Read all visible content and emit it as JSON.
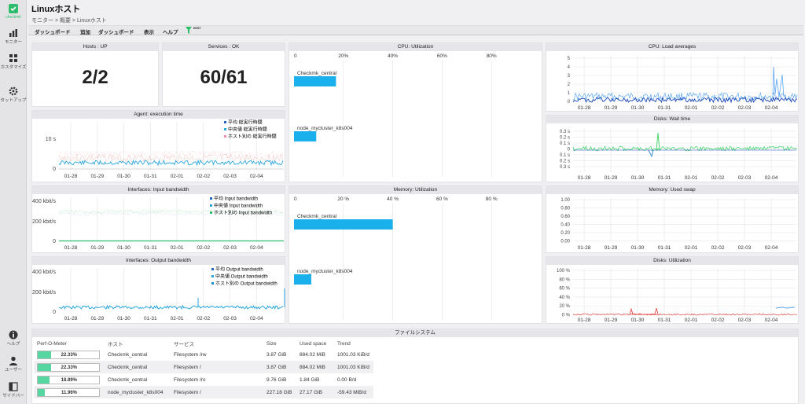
{
  "sidebar": {
    "logo": "checkmk",
    "items": [
      {
        "label": "モニター",
        "icon": "bar-chart-icon"
      },
      {
        "label": "カスタマイズ",
        "icon": "grid-icon"
      },
      {
        "label": "セットアップ",
        "icon": "gear-icon"
      }
    ],
    "bottom": [
      {
        "label": "ヘルプ",
        "icon": "info-icon"
      },
      {
        "label": "ユーザー",
        "icon": "user-icon"
      },
      {
        "label": "サイドバー",
        "icon": "sidebar-icon"
      }
    ]
  },
  "header": {
    "title": "Linuxホスト",
    "breadcrumb": "モニター > 概要 > Linuxホスト"
  },
  "menu": {
    "items": [
      "ダッシュボード",
      "追加",
      "ダッシュボード",
      "表示",
      "ヘルプ"
    ],
    "filter_badge": "HOST"
  },
  "dashlets": {
    "hosts": {
      "title": "Hosts : UP",
      "value": "2/2"
    },
    "services": {
      "title": "Services : OK",
      "value": "60/61"
    },
    "agent": {
      "title": "Agent: execution time",
      "y_tick": "10 s",
      "zero": "0",
      "legend": [
        "平均 総実行時間",
        "中央値 総実行時間",
        "ホスト別の 総実行時間"
      ]
    },
    "in_bw": {
      "title": "Interfaces: Input bandwidth",
      "y_ticks": [
        "400 kbit/s",
        "200 kbit/s",
        "0"
      ],
      "legend": [
        "平均 Input bandwidth",
        "中央値 Input bandwidth",
        "ホスト別の Input bandwidth"
      ]
    },
    "out_bw": {
      "title": "Interfaces: Output bandwidth",
      "y_ticks": [
        "400 kbit/s",
        "200 kbit/s",
        "0"
      ],
      "legend": [
        "平均 Output bandwidth",
        "中央値 Output bandwidth",
        "ホスト別の Output bandwidth"
      ]
    },
    "cpu_util": {
      "title": "CPU: Utilization",
      "ticks": [
        "0",
        "20%",
        "40%",
        "60%",
        "80%"
      ],
      "bars": [
        {
          "label": "Checkmk_central",
          "value": 17
        },
        {
          "label": "node_mycluster_k8s004",
          "value": 9
        }
      ]
    },
    "mem_util": {
      "title": "Memory: Utilization",
      "ticks": [
        "0",
        "20 %",
        "40 %",
        "60 %",
        "80 %"
      ],
      "bars": [
        {
          "label": "Checkmk_central",
          "value": 40
        },
        {
          "label": "node_mycluster_k8s004",
          "value": 7
        }
      ]
    },
    "load": {
      "title": "CPU: Load averages",
      "y_ticks": [
        "5",
        "4",
        "3",
        "2",
        "1",
        "0"
      ]
    },
    "wait": {
      "title": "Disks: Wait time",
      "y_ticks": [
        "0.3 s",
        "0.2 s",
        "0.1 s",
        "0",
        "0.1 s",
        "0.2 s",
        "0.3 s"
      ]
    },
    "swap": {
      "title": "Memory: Used swap",
      "y_ticks": [
        "1.00",
        "0.80",
        "0.60",
        "0.40",
        "0.20",
        "0.00"
      ]
    },
    "disk_util": {
      "title": "Disks: Utilization",
      "y_ticks": [
        "100 %",
        "80 %",
        "60 %",
        "40 %",
        "20 %",
        "0 %"
      ]
    },
    "x_dates": [
      "01-28",
      "01-29",
      "01-30",
      "01-31",
      "02-01",
      "02-02",
      "02-03",
      "02-04"
    ]
  },
  "fs": {
    "title": "ファイルシステム",
    "headers": [
      "Perf-O-Meter",
      "ホスト",
      "サービス",
      "Size",
      "Used space",
      "Trend"
    ],
    "rows": [
      {
        "perf": "22.33%",
        "pct": 22.33,
        "host": "Checkmk_central",
        "service": "Filesystem /rw",
        "size": "3.87 GiB",
        "used": "884.02 MiB",
        "trend": "1001.03 KiB/d"
      },
      {
        "perf": "22.33%",
        "pct": 22.33,
        "host": "Checkmk_central",
        "service": "Filesystem /",
        "size": "3.87 GiB",
        "used": "884.02 MiB",
        "trend": "1001.03 KiB/d"
      },
      {
        "perf": "18.89%",
        "pct": 18.89,
        "host": "Checkmk_central",
        "service": "Filesystem /ro",
        "size": "9.76 GiB",
        "used": "1.84 GiB",
        "trend": "0.00 B/d"
      },
      {
        "perf": "11.96%",
        "pct": 11.96,
        "host": "node_mycluster_k8s004",
        "service": "Filesystem /",
        "size": "227.18 GiB",
        "used": "27.17 GiB",
        "trend": "-59.43 MiB/d"
      }
    ]
  },
  "colors": {
    "bar": "#1ab0ec",
    "line_blue": "#3a8fd8",
    "line_green": "#46d66e",
    "line_red": "#e54a4a",
    "perf": "#56d6a0"
  }
}
